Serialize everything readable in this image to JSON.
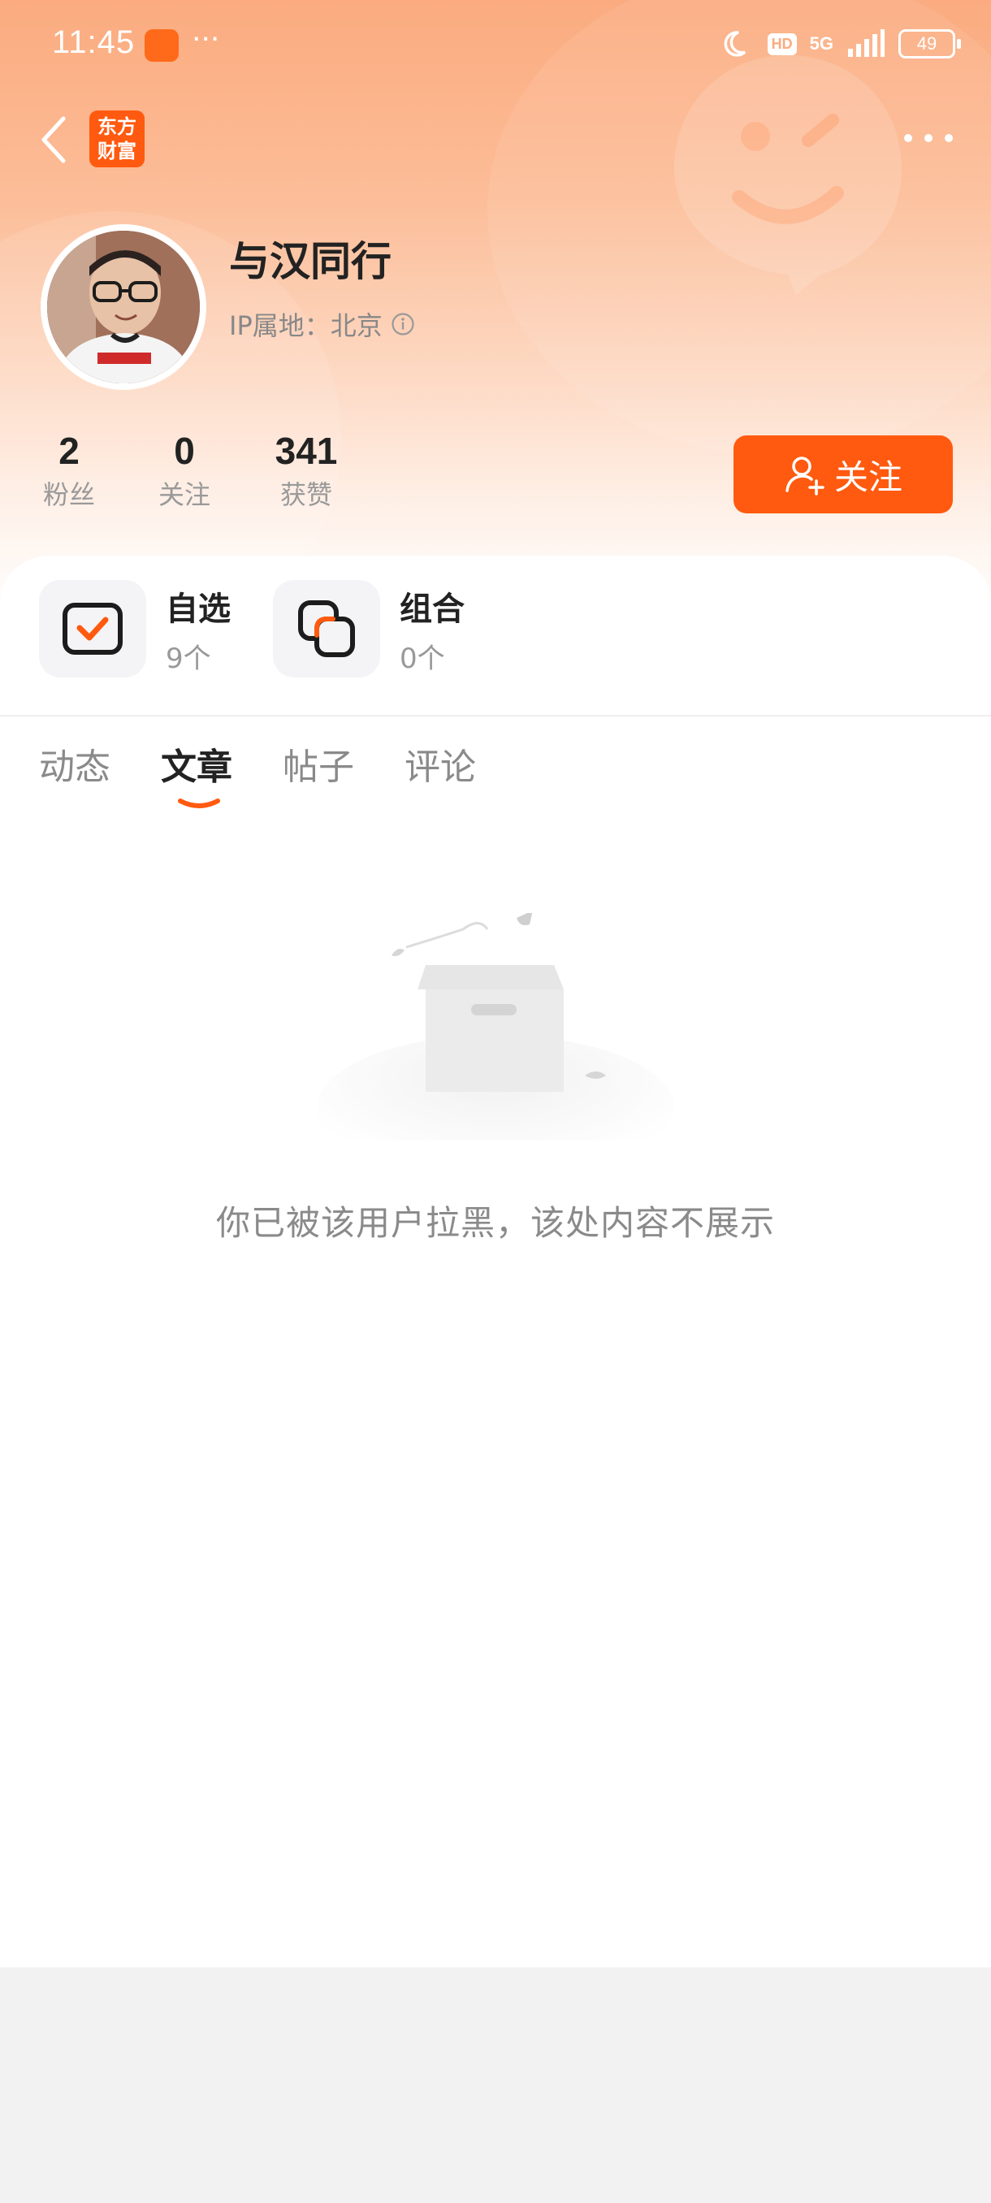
{
  "status_bar": {
    "time": "11:45",
    "network": "5G",
    "hd_badge": "HD",
    "battery": "49"
  },
  "header": {
    "logo_text": "东方\n财富"
  },
  "profile": {
    "username": "与汉同行",
    "ip_location": "IP属地：北京",
    "stats": [
      {
        "value": "2",
        "label": "粉丝"
      },
      {
        "value": "0",
        "label": "关注"
      },
      {
        "value": "341",
        "label": "获赞"
      }
    ],
    "follow_button": "关注"
  },
  "shortcuts": [
    {
      "title": "自选",
      "count": "9个",
      "icon": "checked-box-icon"
    },
    {
      "title": "组合",
      "count": "0个",
      "icon": "overlap-squares-icon"
    }
  ],
  "tabs": [
    {
      "label": "动态",
      "active": false
    },
    {
      "label": "文章",
      "active": true
    },
    {
      "label": "帖子",
      "active": false
    },
    {
      "label": "评论",
      "active": false
    }
  ],
  "empty_state": {
    "message": "你已被该用户拉黑，该处内容不展示"
  },
  "colors": {
    "accent": "#ff5a0f",
    "hero_top": "#fbab7f",
    "text_muted": "#8a8a8a"
  }
}
